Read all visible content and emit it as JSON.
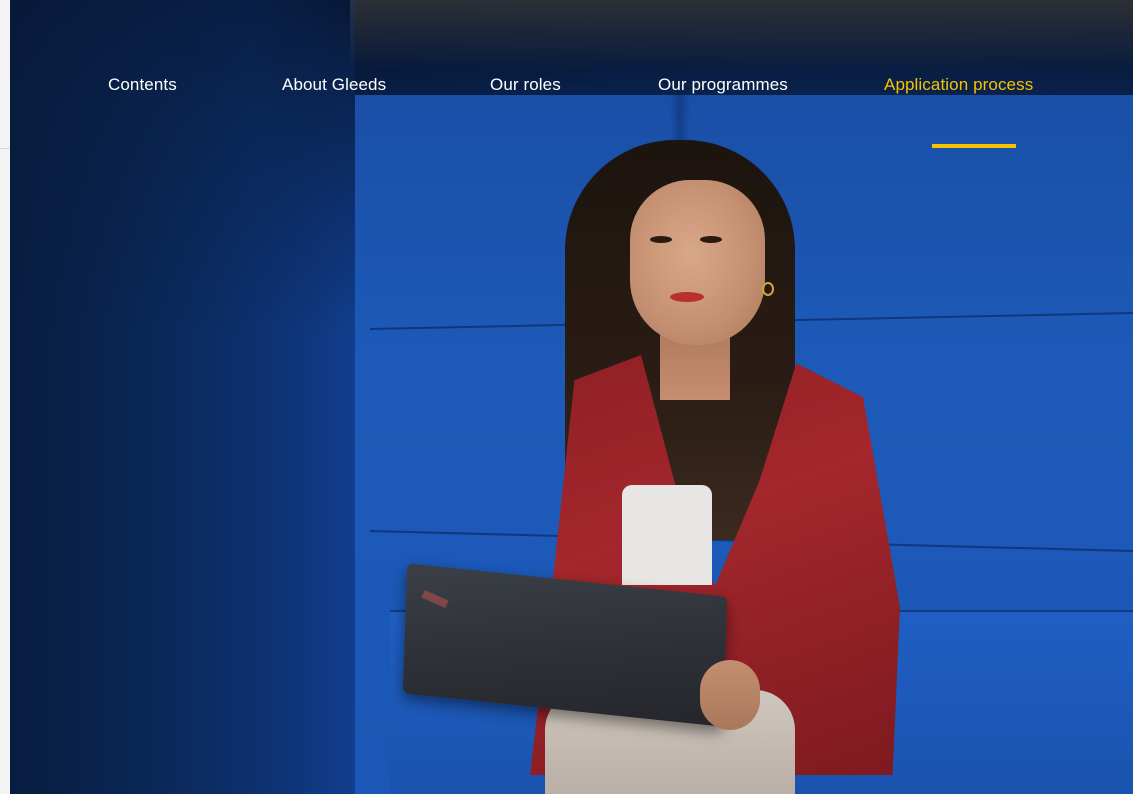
{
  "nav": {
    "items": [
      {
        "label": "Contents",
        "active": false
      },
      {
        "label": "About Gleeds",
        "active": false
      },
      {
        "label": "Our roles",
        "active": false
      },
      {
        "label": "Our programmes",
        "active": false
      },
      {
        "label": "Application process",
        "active": true
      }
    ]
  },
  "colors": {
    "accent": "#f5c300",
    "nav_text": "#ffffff",
    "booth_blue": "#1a55b8",
    "jacket_red": "#a3272c"
  },
  "hero": {
    "image_subject": "woman in red blazer with laptop seated in blue booth"
  }
}
